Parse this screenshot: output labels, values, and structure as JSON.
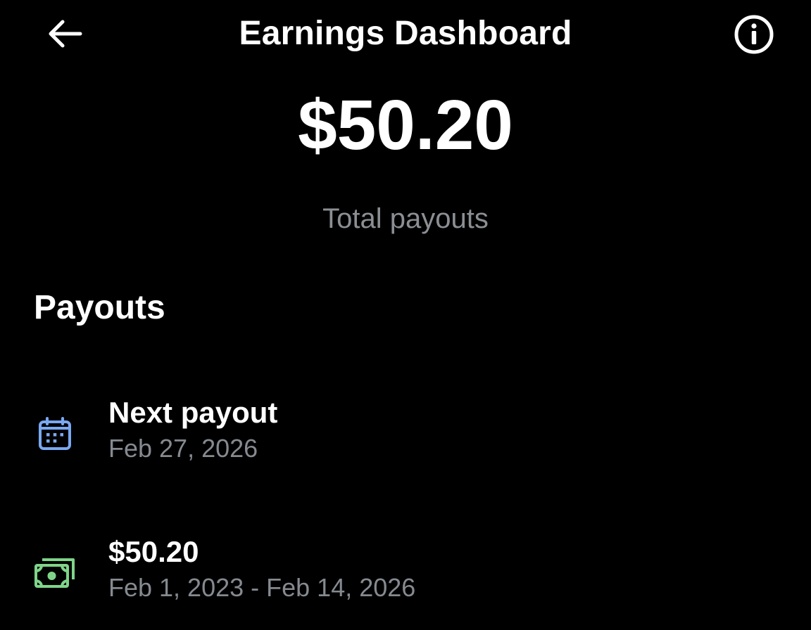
{
  "header": {
    "title": "Earnings Dashboard",
    "back_icon": "arrow-left-icon",
    "info_icon": "info-circle-icon"
  },
  "summary": {
    "amount": "$50.20",
    "label": "Total payouts"
  },
  "payouts": {
    "title": "Payouts",
    "items": [
      {
        "icon": "calendar-icon",
        "icon_color": "#7aa8f0",
        "primary": "Next payout",
        "secondary": "Feb 27, 2026"
      },
      {
        "icon": "money-icon",
        "icon_color": "#7fd48a",
        "primary": "$50.20",
        "secondary": "Feb 1, 2023 - Feb 14, 2026"
      }
    ]
  },
  "colors": {
    "background": "#000000",
    "text_primary": "#ffffff",
    "text_secondary": "#858a90"
  }
}
